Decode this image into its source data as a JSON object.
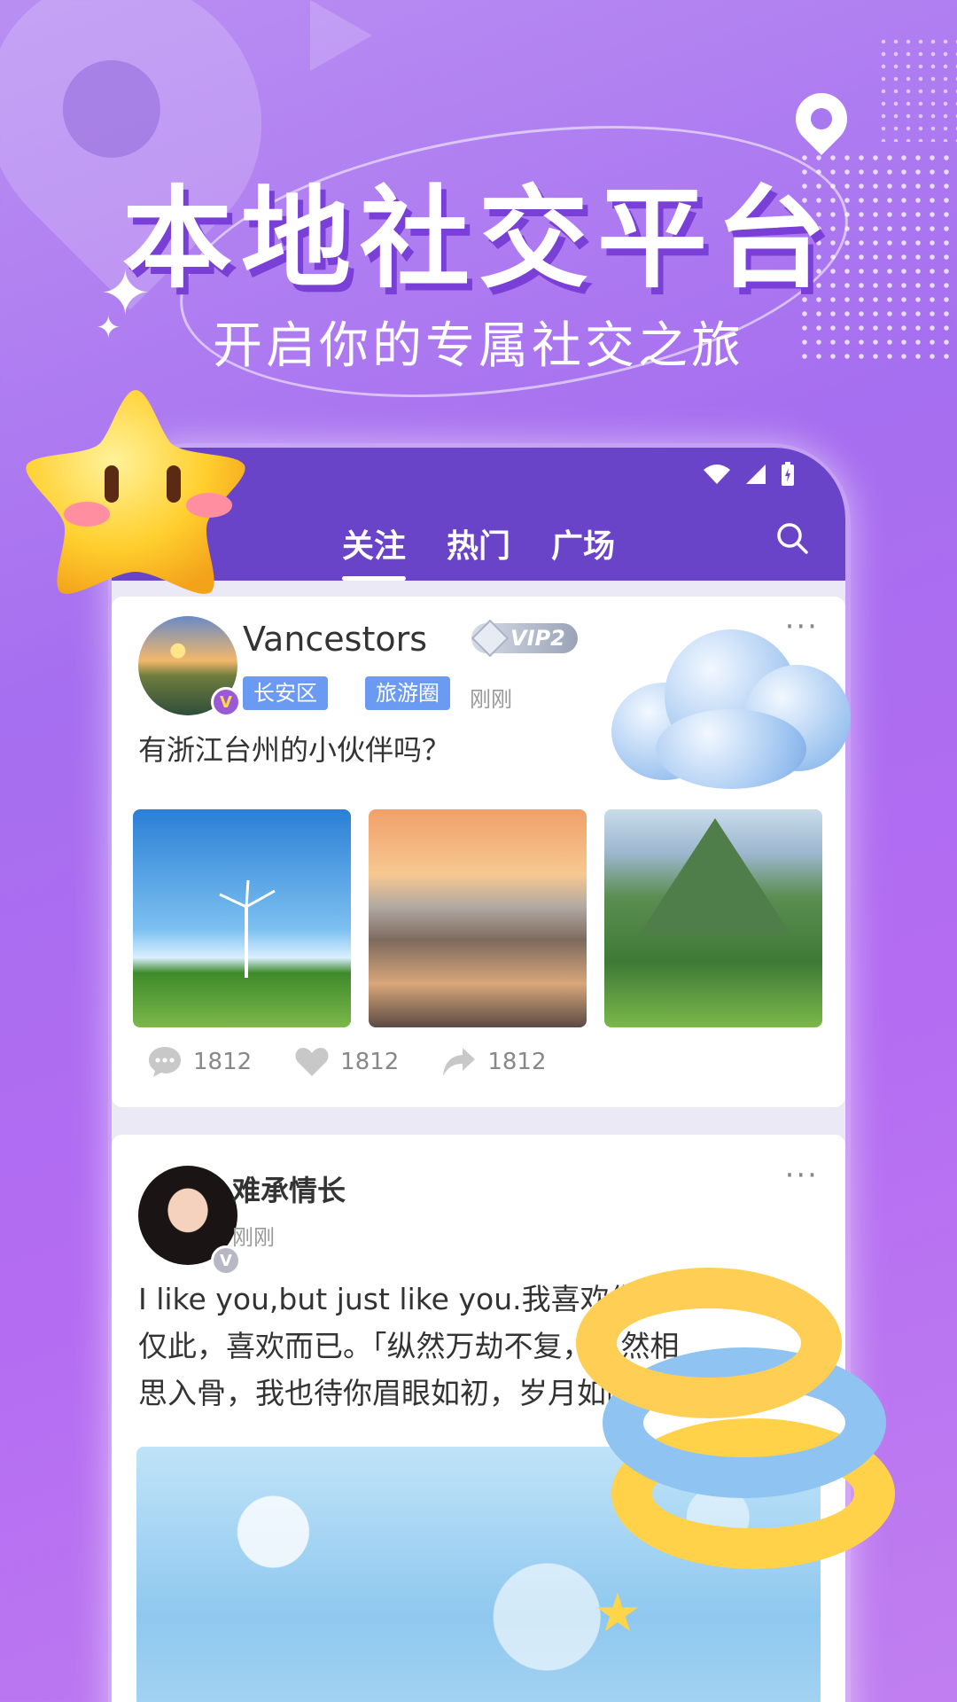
{
  "promo": {
    "headline": "本地社交平台",
    "subline": "开启你的专属社交之旅"
  },
  "app": {
    "tabs": [
      {
        "label": "关注",
        "active": true
      },
      {
        "label": "热门",
        "active": false
      },
      {
        "label": "广场",
        "active": false
      }
    ]
  },
  "posts": [
    {
      "username": "Vancestors",
      "vip_label": "VIP2",
      "badge": "V",
      "tags": [
        "长安区",
        "旅游圈"
      ],
      "time": "刚刚",
      "text": "有浙江台州的小伙伴吗？",
      "comments": "1812",
      "likes": "1812",
      "shares": "1812"
    },
    {
      "username": "难承情长",
      "badge": "V",
      "time": "刚刚",
      "text": "I like you,but just like you.我喜欢你，仅此，喜欢而已。「纵然万劫不复，纵然相思入骨，我也待你眉眼如初，岁月如故。」"
    }
  ],
  "colors": {
    "header": "#6a44c8",
    "tag": "#6a9af2",
    "accent": "#a66ef0"
  },
  "icons": {
    "more": "···",
    "search": "search-icon",
    "comment": "comment-icon",
    "like": "heart-icon",
    "share": "share-icon"
  }
}
